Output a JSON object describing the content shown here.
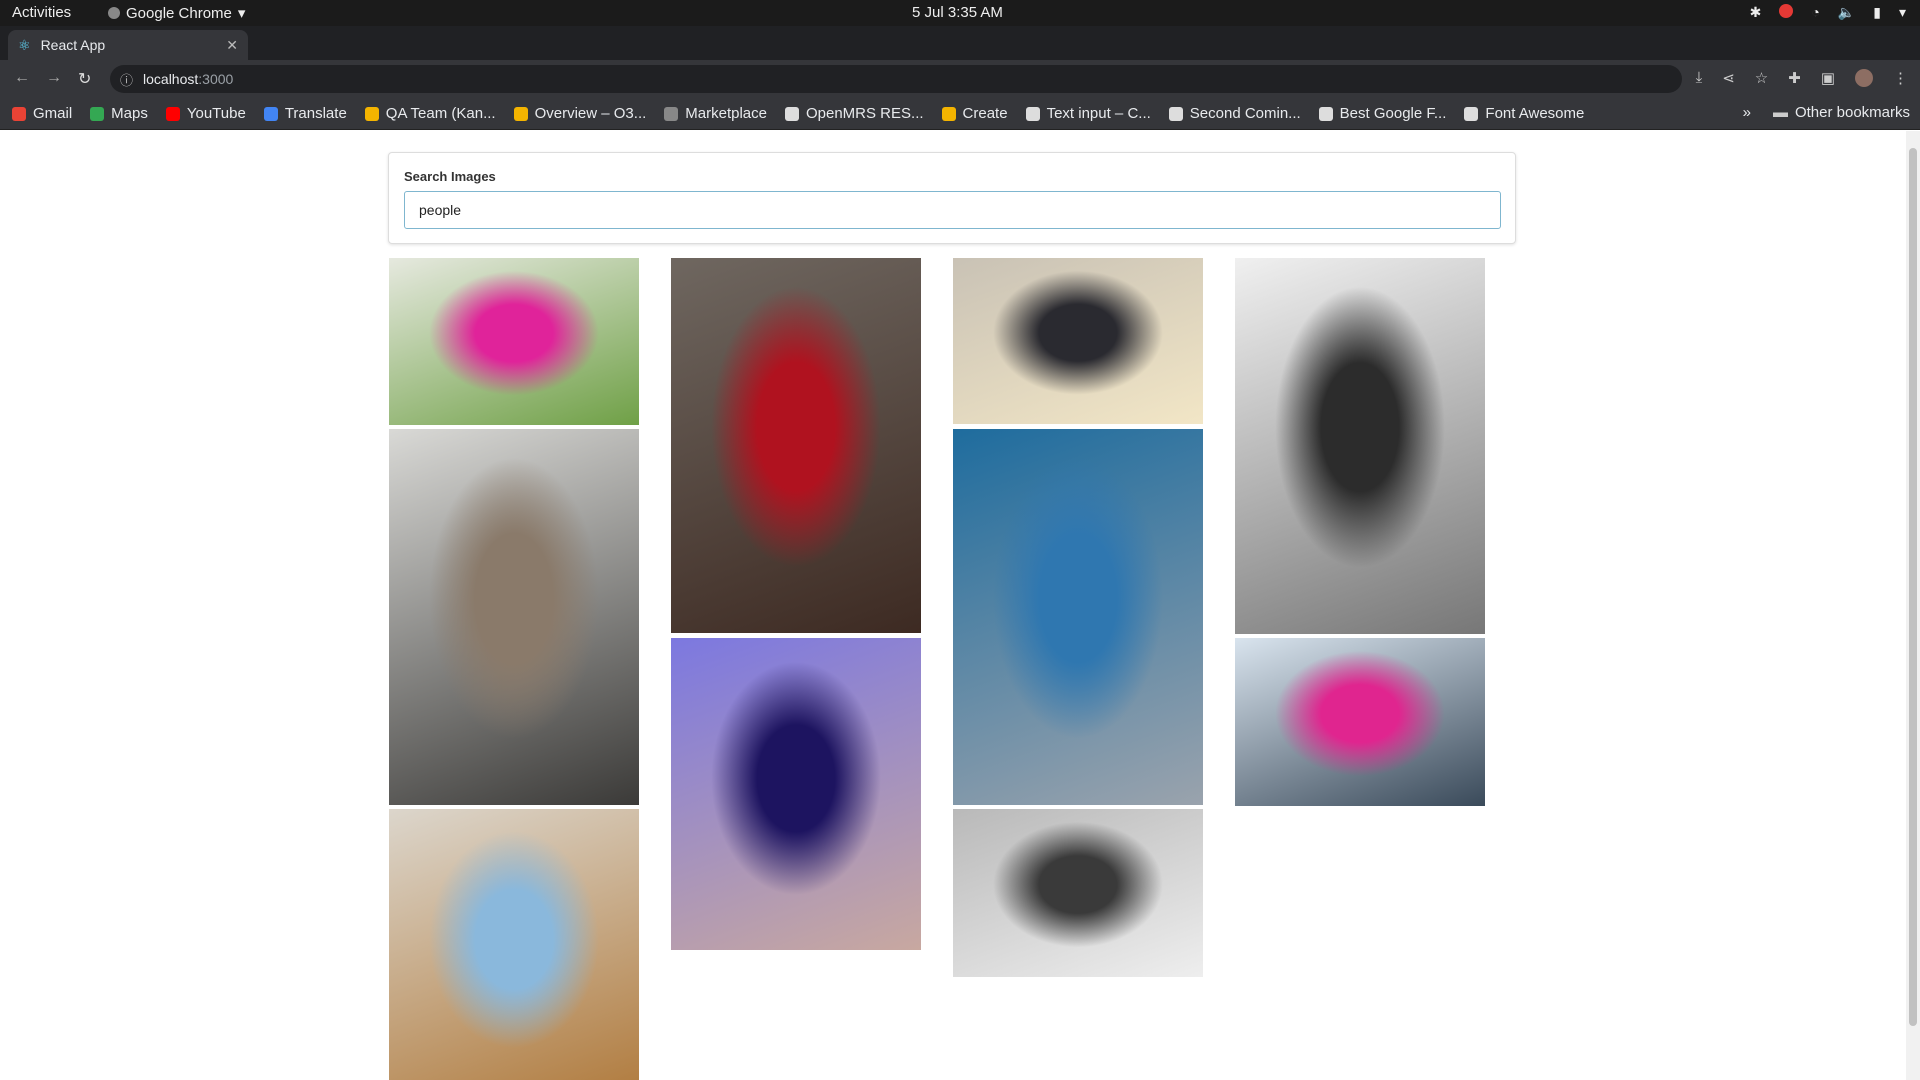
{
  "system_bar": {
    "activities": "Activities",
    "app_name": "Google Chrome",
    "clock": "5 Jul  3:35 AM"
  },
  "browser": {
    "tab_title": "React App",
    "url_host": "localhost",
    "url_port": ":3000",
    "bookmarks": [
      {
        "label": "Gmail",
        "color": "#ea4335"
      },
      {
        "label": "Maps",
        "color": "#34a853"
      },
      {
        "label": "YouTube",
        "color": "#ff0000"
      },
      {
        "label": "Translate",
        "color": "#4285f4"
      },
      {
        "label": "QA Team (Kan...",
        "color": "#f4b400"
      },
      {
        "label": "Overview – O3...",
        "color": "#f4b400"
      },
      {
        "label": "Marketplace",
        "color": "#888888"
      },
      {
        "label": "OpenMRS RES...",
        "color": "#dddddd"
      },
      {
        "label": "Create",
        "color": "#f4b400"
      },
      {
        "label": "Text input – C...",
        "color": "#dddddd"
      },
      {
        "label": "Second Comin...",
        "color": "#dddddd"
      },
      {
        "label": "Best Google F...",
        "color": "#dddddd"
      },
      {
        "label": "Font Awesome",
        "color": "#dddddd"
      }
    ],
    "other_bookmarks": "Other bookmarks"
  },
  "search": {
    "label": "Search Images",
    "value": "people"
  },
  "gallery": {
    "photos": [
      {
        "subject": "two women in pink at event",
        "colors": [
          "#e6e9df",
          "#e0239a",
          "#6fa046"
        ]
      },
      {
        "subject": "young man with black hat",
        "colors": [
          "#d9d9d6",
          "#8a7a6a",
          "#3b3a38"
        ]
      },
      {
        "subject": "man sitting below round window",
        "colors": [
          "#dcd6cc",
          "#8ab8dc",
          "#b07a3c"
        ]
      },
      {
        "subject": "smiling woman in red top",
        "colors": [
          "#6f6760",
          "#b0121f",
          "#3d2a22"
        ]
      },
      {
        "subject": "woman portrait purple light",
        "colors": [
          "#7c78e0",
          "#1d1460",
          "#c8a8a0"
        ]
      },
      {
        "subject": "crowd on crosswalk at sunset",
        "colors": [
          "#c9c2b5",
          "#2a2a30",
          "#f2e6c6"
        ]
      },
      {
        "subject": "woman in hoodie by blue wall",
        "colors": [
          "#1e6c9e",
          "#2f77b0",
          "#9aa3ad"
        ]
      },
      {
        "subject": "aerial crowd crossing",
        "colors": [
          "#b9b9b9",
          "#3a3a3a",
          "#eeeeee"
        ]
      },
      {
        "subject": "aerial striped crosswalk with people",
        "colors": [
          "#f0f0f0",
          "#2c2c2c",
          "#777777"
        ]
      },
      {
        "subject": "pink flag rally crowd",
        "colors": [
          "#d9e4ee",
          "#e0258f",
          "#3a4a5a"
        ]
      }
    ]
  }
}
